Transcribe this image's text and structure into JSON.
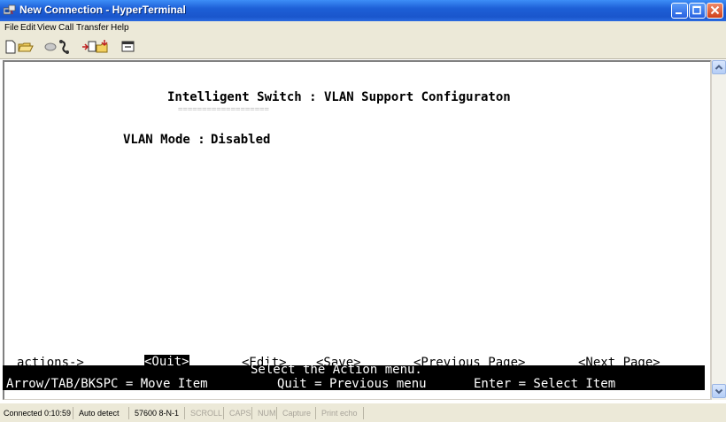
{
  "window": {
    "title": "New Connection - HyperTerminal",
    "controls": {
      "minimize": "minimize",
      "maximize": "maximize",
      "close": "close"
    }
  },
  "menu": [
    "File",
    "Edit",
    "View",
    "Call",
    "Transfer",
    "Help"
  ],
  "toolbar": {
    "buttons": [
      "new-connection-icon",
      "open-folder-icon",
      "connect-phone-icon",
      "disconnect-phone-icon",
      "send-file-icon",
      "receive-file-icon",
      "properties-icon"
    ]
  },
  "terminal": {
    "screen_title": "Intelligent Switch : VLAN Support Configuraton",
    "title_underline": "===================",
    "vlan_mode_label": "VLAN Mode :",
    "vlan_mode_value": "Disabled",
    "actions_label": "actions->",
    "actions": {
      "quit": "<Quit>",
      "edit": "<Edit>",
      "save": "<Save>",
      "previous_page": "<Previous Page>",
      "next_page": "<Next Page>"
    },
    "status_message": "Select the Action menu.",
    "help": {
      "move": "Arrow/TAB/BKSPC = Move Item",
      "quit": "Quit = Previous menu",
      "enter": "Enter = Select Item"
    }
  },
  "statusbar": {
    "connected": "Connected 0:10:59",
    "detect": "Auto detect",
    "settings": "57600 8-N-1",
    "scroll": "SCROLL",
    "caps": "CAPS",
    "num": "NUM",
    "capture": "Capture",
    "print_echo": "Print echo"
  },
  "colors": {
    "titlebar": "#1d5fd6",
    "chrome": "#ece9d8",
    "terminal_bg": "#ffffff",
    "inverse_bg": "#000000"
  }
}
